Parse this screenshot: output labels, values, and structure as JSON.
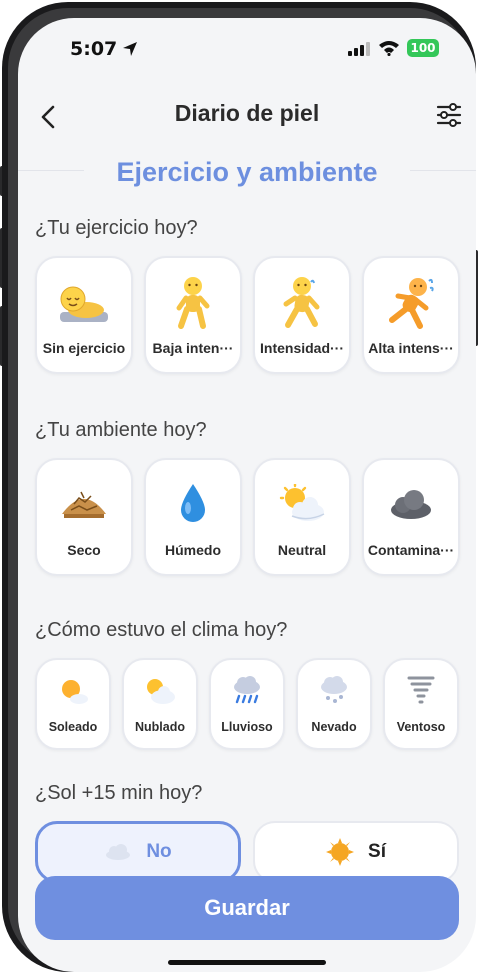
{
  "status_bar": {
    "time": "5:07",
    "battery": "100"
  },
  "header": {
    "title": "Diario de piel"
  },
  "section": {
    "title": "Ejercicio y ambiente"
  },
  "exercise": {
    "question": "¿Tu ejercicio hoy?",
    "options": [
      {
        "label": "Sin ejercicio",
        "icon": "person-lying-icon"
      },
      {
        "label": "Baja inten···",
        "icon": "person-walking-icon"
      },
      {
        "label": "Intensidad···",
        "icon": "person-walking-fast-icon"
      },
      {
        "label": "Alta intens···",
        "icon": "person-running-icon"
      }
    ]
  },
  "environment": {
    "question": "¿Tu ambiente hoy?",
    "options": [
      {
        "label": "Seco",
        "icon": "dry-ground-icon"
      },
      {
        "label": "Húmedo",
        "icon": "water-drop-icon"
      },
      {
        "label": "Neutral",
        "icon": "sun-behind-cloud-icon"
      },
      {
        "label": "Contamina···",
        "icon": "dark-cloud-icon"
      }
    ]
  },
  "weather": {
    "question": "¿Cómo estuvo el clima hoy?",
    "options": [
      {
        "label": "Soleado",
        "icon": "sun-small-cloud-icon"
      },
      {
        "label": "Nublado",
        "icon": "sun-behind-cloud-icon"
      },
      {
        "label": "Lluvioso",
        "icon": "rain-cloud-icon"
      },
      {
        "label": "Nevado",
        "icon": "snow-cloud-icon"
      },
      {
        "label": "Ventoso",
        "icon": "tornado-icon"
      }
    ]
  },
  "sun_exposure": {
    "question": "¿Sol +15 min hoy?",
    "no_label": "No",
    "yes_label": "Sí",
    "selected": "No"
  },
  "save_button": {
    "label": "Guardar"
  },
  "colors": {
    "accent": "#6f8fe0",
    "background": "#f4f5f7",
    "selected_bg": "#eef2fd"
  }
}
